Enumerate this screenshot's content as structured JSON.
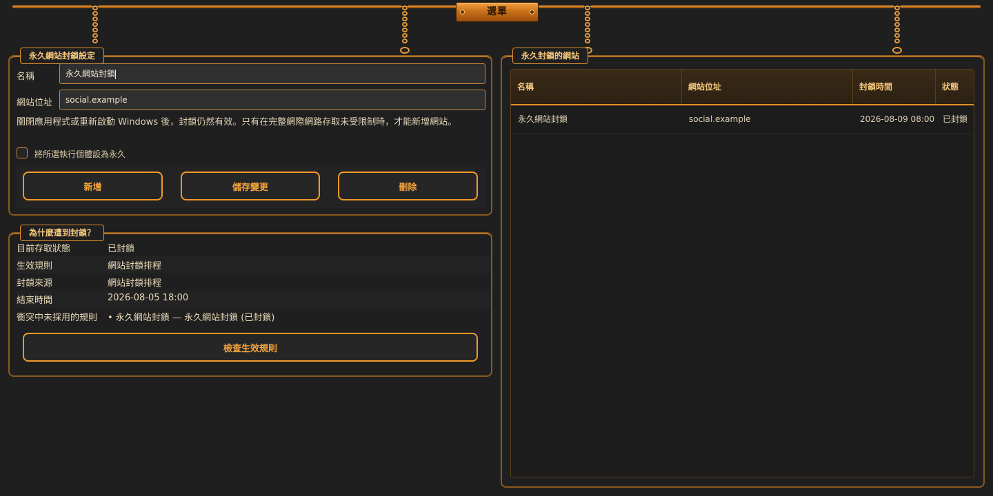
{
  "menu": {
    "title": "選單"
  },
  "settings_panel": {
    "title": "永久網站封鎖設定",
    "name_label": "名稱",
    "name_value": "永久網站封鎖",
    "url_label": "網站位址",
    "url_value": "social.example",
    "description": "關閉應用程式或重新啟動 Windows 後，封鎖仍然有效。只有在完整網際網路存取未受限制時，才能新增網站。",
    "checkbox_label": "將所選執行個體設為永久",
    "checkbox_checked": false,
    "buttons": {
      "add": "新增",
      "save": "儲存變更",
      "delete": "刪除"
    }
  },
  "why_panel": {
    "title": "為什麼遭到封鎖？",
    "rows": [
      {
        "key": "目前存取狀態",
        "value": "已封鎖"
      },
      {
        "key": "生效規則",
        "value": "網站封鎖排程"
      },
      {
        "key": "封鎖來源",
        "value": "網站封鎖排程"
      },
      {
        "key": "結束時間",
        "value": "2026-08-05 18:00"
      },
      {
        "key": "衝突中未採用的規則",
        "value": "• 永久網站封鎖 — 永久網站封鎖 (已封鎖)"
      }
    ],
    "check_button": "檢查生效規則"
  },
  "sites_panel": {
    "title": "永久封鎖的網站",
    "columns": [
      "名稱",
      "網站位址",
      "封鎖時間",
      "狀態"
    ],
    "rows": [
      [
        "永久網站封鎖",
        "social.example",
        "2026-08-09 08:00",
        "已封鎖"
      ]
    ]
  },
  "colors": {
    "accent": "#f39a2a",
    "background": "#1f1f1f",
    "border": "#8a5a1e"
  }
}
